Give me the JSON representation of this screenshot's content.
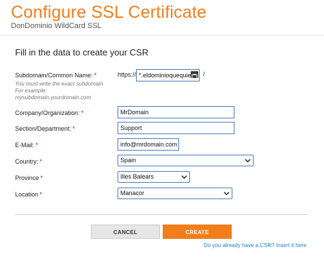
{
  "header": {
    "title": "Configure SSL Certificate",
    "subtitle": "DonDominio WildCard SSL"
  },
  "form": {
    "heading": "Fill in the data to create your CSR",
    "required_marker": "*",
    "subdomain": {
      "label": "Subdomain/Common Name:",
      "hint_line1": "You must write the exact subdomain.",
      "hint_line2": "For example:",
      "hint_line3": "mysubdomain.yourdomain.com",
      "prefix": "https://",
      "value": "*.eldominioquequie",
      "suffix": "/"
    },
    "company": {
      "label": "Company/Organization:",
      "value": "MrDomain"
    },
    "section": {
      "label": "Section/Department:",
      "value": "Support"
    },
    "email": {
      "label": "E-Mail:",
      "value": "info@mrdomain.com"
    },
    "country": {
      "label": "Country:",
      "value": "Spain"
    },
    "province": {
      "label": "Province",
      "value": "Illes Balears"
    },
    "location": {
      "label": "Location",
      "value": "Manacor"
    }
  },
  "actions": {
    "cancel_label": "CANCEL",
    "create_label": "CREATE",
    "csr_link": "Do you already have a CSR? Insert it here"
  },
  "colors": {
    "accent": "#f07e1a",
    "link": "#1a7fd4",
    "field_border": "#4a7ab4",
    "required": "#d0021b"
  },
  "icons": [
    "clipboard-icon",
    "chevron-down-icon"
  ]
}
